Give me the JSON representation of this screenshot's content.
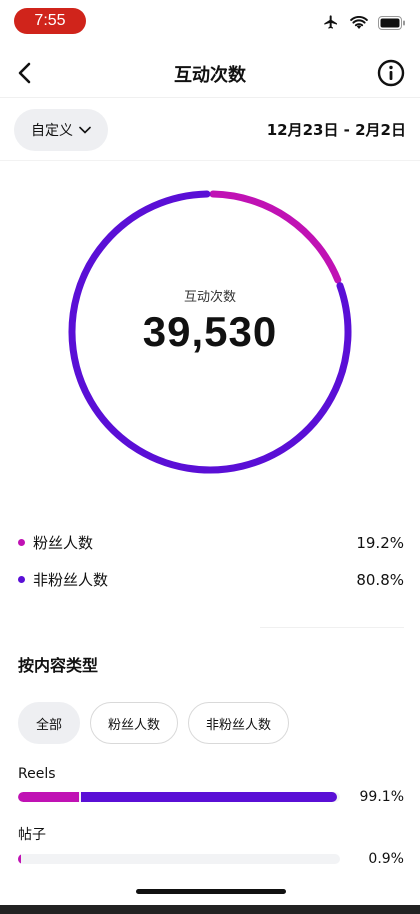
{
  "status_bar": {
    "time": "7:55",
    "icons": [
      "airplane-icon",
      "wifi-icon",
      "battery-icon"
    ],
    "time_color": "#d0241b"
  },
  "header": {
    "title": "互动次数",
    "back_icon": "chevron-left-icon",
    "info_icon": "info-icon"
  },
  "filter": {
    "range_label": "自定义",
    "date_range": "12月23日 - 2月2日"
  },
  "summary": {
    "label": "互动次数",
    "total": "39,530"
  },
  "colors": {
    "followers": "#c012b4",
    "non_followers": "#5a0fd6"
  },
  "chart_data": {
    "type": "pie",
    "variant": "donut",
    "categories": [
      "粉丝人数",
      "非粉丝人数"
    ],
    "values": [
      19.2,
      80.8
    ],
    "unit": "%",
    "title": "互动次数",
    "center_value": "39,530"
  },
  "legend": [
    {
      "label": "粉丝人数",
      "percent": "19.2%",
      "color": "#c012b4"
    },
    {
      "label": "非粉丝人数",
      "percent": "80.8%",
      "color": "#5a0fd6"
    }
  ],
  "by_content": {
    "title": "按内容类型",
    "tabs": [
      {
        "label": "全部",
        "active": true
      },
      {
        "label": "粉丝人数",
        "active": false
      },
      {
        "label": "非粉丝人数",
        "active": false
      }
    ],
    "rows": [
      {
        "label": "Reels",
        "percent": "99.1%",
        "share": 0.991,
        "follower_fraction": 0.192
      },
      {
        "label": "帖子",
        "percent": "0.9%",
        "share": 0.009,
        "follower_fraction": 1.0
      }
    ]
  }
}
